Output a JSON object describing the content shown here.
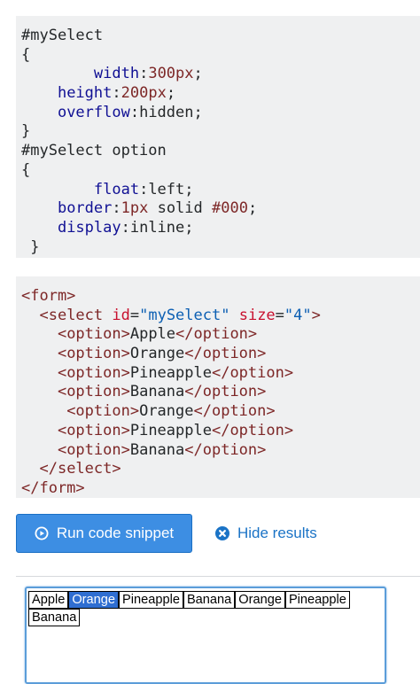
{
  "css_code": {
    "lines": [
      [
        {
          "t": "plain",
          "v": "#mySelect"
        }
      ],
      [
        {
          "t": "plain",
          "v": "{"
        }
      ],
      [
        {
          "t": "plain",
          "v": "        "
        },
        {
          "t": "prop",
          "v": "width"
        },
        {
          "t": "plain",
          "v": ":"
        },
        {
          "t": "num",
          "v": "300px"
        },
        {
          "t": "plain",
          "v": ";"
        }
      ],
      [
        {
          "t": "plain",
          "v": "    "
        },
        {
          "t": "prop",
          "v": "height"
        },
        {
          "t": "plain",
          "v": ":"
        },
        {
          "t": "num",
          "v": "200px"
        },
        {
          "t": "plain",
          "v": ";"
        }
      ],
      [
        {
          "t": "plain",
          "v": "    "
        },
        {
          "t": "prop",
          "v": "overflow"
        },
        {
          "t": "plain",
          "v": ":hidden;"
        }
      ],
      [
        {
          "t": "plain",
          "v": "}"
        }
      ],
      [
        {
          "t": "plain",
          "v": "#mySelect option"
        }
      ],
      [
        {
          "t": "plain",
          "v": "{"
        }
      ],
      [
        {
          "t": "plain",
          "v": "        "
        },
        {
          "t": "prop",
          "v": "float"
        },
        {
          "t": "plain",
          "v": ":left;"
        }
      ],
      [
        {
          "t": "plain",
          "v": "    "
        },
        {
          "t": "prop",
          "v": "border"
        },
        {
          "t": "plain",
          "v": ":"
        },
        {
          "t": "num",
          "v": "1px"
        },
        {
          "t": "plain",
          "v": " solid "
        },
        {
          "t": "num",
          "v": "#000"
        },
        {
          "t": "plain",
          "v": ";"
        }
      ],
      [
        {
          "t": "plain",
          "v": "    "
        },
        {
          "t": "prop",
          "v": "display"
        },
        {
          "t": "plain",
          "v": ":inline;"
        }
      ],
      [
        {
          "t": "plain",
          "v": " }"
        }
      ]
    ]
  },
  "html_code": {
    "lines": [
      [
        {
          "t": "tag",
          "v": "<form>"
        }
      ],
      [
        {
          "t": "plain",
          "v": "  "
        },
        {
          "t": "tag",
          "v": "<select "
        },
        {
          "t": "attr",
          "v": "id"
        },
        {
          "t": "plain",
          "v": "="
        },
        {
          "t": "str",
          "v": "\"mySelect\""
        },
        {
          "t": "plain",
          "v": " "
        },
        {
          "t": "attr",
          "v": "size"
        },
        {
          "t": "plain",
          "v": "="
        },
        {
          "t": "str",
          "v": "\"4\""
        },
        {
          "t": "tag",
          "v": ">"
        }
      ],
      [
        {
          "t": "plain",
          "v": "    "
        },
        {
          "t": "tag",
          "v": "<option>"
        },
        {
          "t": "text",
          "v": "Apple"
        },
        {
          "t": "tag",
          "v": "</option>"
        }
      ],
      [
        {
          "t": "plain",
          "v": "    "
        },
        {
          "t": "tag",
          "v": "<option>"
        },
        {
          "t": "text",
          "v": "Orange"
        },
        {
          "t": "tag",
          "v": "</option>"
        }
      ],
      [
        {
          "t": "plain",
          "v": "    "
        },
        {
          "t": "tag",
          "v": "<option>"
        },
        {
          "t": "text",
          "v": "Pineapple"
        },
        {
          "t": "tag",
          "v": "</option>"
        }
      ],
      [
        {
          "t": "plain",
          "v": "    "
        },
        {
          "t": "tag",
          "v": "<option>"
        },
        {
          "t": "text",
          "v": "Banana"
        },
        {
          "t": "tag",
          "v": "</option>"
        }
      ],
      [
        {
          "t": "plain",
          "v": "     "
        },
        {
          "t": "tag",
          "v": "<option>"
        },
        {
          "t": "text",
          "v": "Orange"
        },
        {
          "t": "tag",
          "v": "</option>"
        }
      ],
      [
        {
          "t": "plain",
          "v": "    "
        },
        {
          "t": "tag",
          "v": "<option>"
        },
        {
          "t": "text",
          "v": "Pineapple"
        },
        {
          "t": "tag",
          "v": "</option>"
        }
      ],
      [
        {
          "t": "plain",
          "v": "    "
        },
        {
          "t": "tag",
          "v": "<option>"
        },
        {
          "t": "text",
          "v": "Banana"
        },
        {
          "t": "tag",
          "v": "</option>"
        }
      ],
      [
        {
          "t": "plain",
          "v": "  "
        },
        {
          "t": "tag",
          "v": "</select>"
        }
      ],
      [
        {
          "t": "tag",
          "v": "</form>"
        }
      ]
    ]
  },
  "actions": {
    "run_label": "Run code snippet",
    "run_icon": "play-circle-icon",
    "hide_label": "Hide results",
    "hide_icon": "close-circle-icon"
  },
  "result": {
    "options": [
      "Apple",
      "Orange",
      "Pineapple",
      "Banana",
      "Orange",
      "Pineapple",
      "Banana"
    ],
    "selected_index": 1
  },
  "colors": {
    "accent": "#3d8ee3",
    "link": "#1a73c6",
    "code_bg": "#eff0f1",
    "selected_option": "#2f6ed1"
  }
}
